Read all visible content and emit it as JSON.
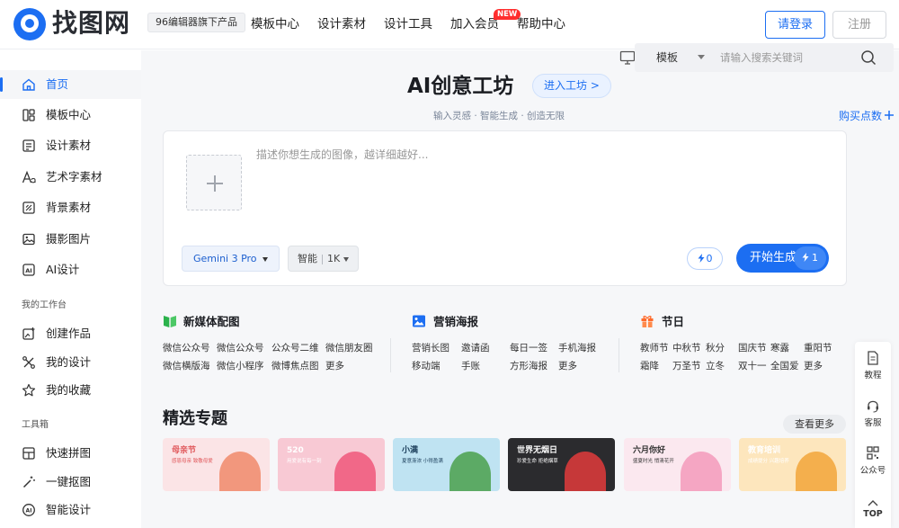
{
  "header": {
    "logo_text": "找图网",
    "brand_tag": "96编辑器旗下产品",
    "nav": [
      "模板中心",
      "设计素材",
      "设计工具",
      "加入会员",
      "帮助中心"
    ],
    "new_badge": "NEW",
    "login": "请登录",
    "register": "注册"
  },
  "sidebar": {
    "items": [
      {
        "label": "首页",
        "icon": "home-icon"
      },
      {
        "label": "模板中心",
        "icon": "template-icon"
      },
      {
        "label": "设计素材",
        "icon": "material-icon"
      },
      {
        "label": "艺术字素材",
        "icon": "font-icon"
      },
      {
        "label": "背景素材",
        "icon": "background-icon"
      },
      {
        "label": "摄影图片",
        "icon": "image-icon"
      },
      {
        "label": "AI设计",
        "icon": "ai-icon"
      }
    ],
    "workspace_title": "我的工作台",
    "workspace": [
      {
        "label": "创建作品",
        "icon": "create-icon"
      },
      {
        "label": "我的设计",
        "icon": "my-design-icon"
      },
      {
        "label": "我的收藏",
        "icon": "star-icon"
      }
    ],
    "tools_title": "工具箱",
    "tools": [
      {
        "label": "快速拼图",
        "icon": "collage-icon"
      },
      {
        "label": "一键抠图",
        "icon": "magic-wand-icon"
      },
      {
        "label": "智能设计",
        "icon": "smart-design-icon"
      }
    ]
  },
  "search": {
    "type": "模板",
    "placeholder": "请输入搜索关键词"
  },
  "ai": {
    "title": "AI创意工坊",
    "enter": "进入工坊 >",
    "subtitle": "输入灵感 · 智能生成 · 创造无限",
    "buy_points": "购买点数",
    "prompt_placeholder": "描述你想生成的图像，越详细越好...",
    "model": "Gemini 3 Pro",
    "mode": "智能",
    "resolution": "1K",
    "points": "0",
    "generate": "开始生成",
    "cost": "1"
  },
  "categories": [
    {
      "title": "新媒体配图",
      "icon": "book-icon",
      "color": "#2bb24c",
      "links": [
        [
          "微信公众号",
          "微信公众号",
          "公众号二维",
          "微信朋友圈"
        ],
        [
          "微信横版海",
          "微信小程序",
          "微博焦点图",
          "更多"
        ]
      ]
    },
    {
      "title": "营销海报",
      "icon": "poster-icon",
      "color": "#1c6ef2",
      "links": [
        [
          "营销长图",
          "邀请函",
          "每日一签",
          "手机海报"
        ],
        [
          "移动端",
          "手账",
          "方形海报",
          "更多"
        ]
      ]
    },
    {
      "title": "节日",
      "icon": "gift-icon",
      "color": "#ff6a2b",
      "links": [
        [
          "教师节",
          "中秋节",
          "秋分",
          "国庆节",
          "寒露",
          "重阳节"
        ],
        [
          "霜降",
          "万圣节",
          "立冬",
          "双十一",
          "全国爱",
          "更多"
        ]
      ]
    }
  ],
  "featured": {
    "title": "精选专题",
    "more": "查看更多",
    "topics": [
      {
        "title": "母亲节",
        "sub": "感恩母亲 致敬母爱",
        "bg": "#fbe4e6",
        "accent": "#f08a6a",
        "tc": "#e0575a"
      },
      {
        "title": "520",
        "sub": "用爱说有每一刻",
        "bg": "#f8c9d4",
        "accent": "#f0577a",
        "tc": "#ffffff"
      },
      {
        "title": "小满",
        "sub": "夏意渐浓 小得盈满",
        "bg": "#bfe3f2",
        "accent": "#4aa04c",
        "tc": "#1b3d5a"
      },
      {
        "title": "世界无烟日",
        "sub": "珍爱生命 拒绝烟草",
        "bg": "#2b2b2e",
        "accent": "#e23b3b",
        "tc": "#ffffff"
      },
      {
        "title": "六月你好",
        "sub": "盛夏时光 悄清花开",
        "bg": "#fbe8ef",
        "accent": "#f39abb",
        "tc": "#333333"
      },
      {
        "title": "教育培训",
        "sub": "成绩提分 兴趣培养",
        "bg": "#fde6bd",
        "accent": "#f2a53a",
        "tc": "#ffffff"
      }
    ]
  },
  "rail": [
    {
      "label": "教程",
      "icon": "document-icon"
    },
    {
      "label": "客服",
      "icon": "headset-icon"
    },
    {
      "label": "公众号",
      "icon": "qrcode-icon"
    },
    {
      "label": "TOP",
      "icon": "arrow-up-icon"
    }
  ]
}
